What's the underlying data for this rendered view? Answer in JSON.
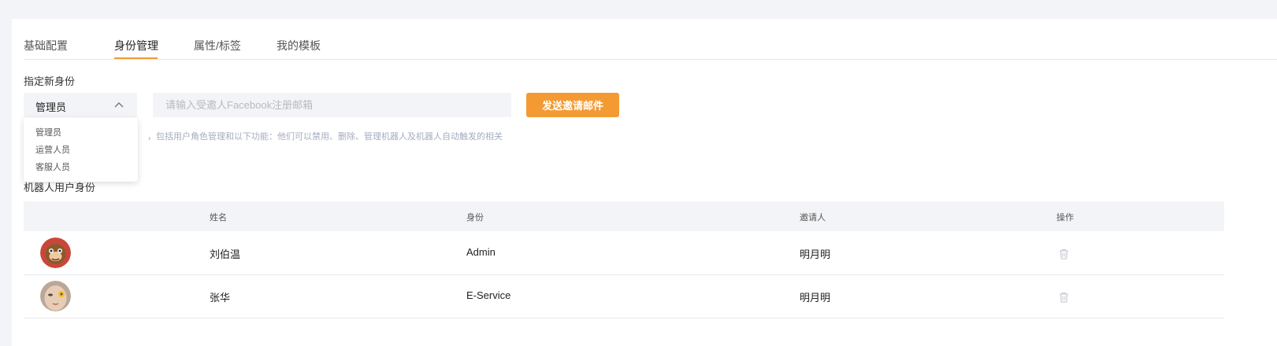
{
  "tabs": [
    {
      "label": "基础配置"
    },
    {
      "label": "身份管理"
    },
    {
      "label": "属性/标签"
    },
    {
      "label": "我的模板"
    }
  ],
  "active_tab": "身份管理",
  "invite": {
    "section_label": "指定新身份",
    "selected_role": "管理员",
    "email_placeholder": "请输入受邀人Facebook注册邮箱",
    "email_value": "",
    "send_label": "发送邀请邮件",
    "description_visible": "，包括用户角色管理和以下功能：他们可以禁用、删除、管理机器人及机器人自动触发的相关",
    "description_line2": "机器人用户身份"
  },
  "role_dropdown": {
    "open": true,
    "options": [
      "管理员",
      "运营人员",
      "客服人员"
    ]
  },
  "table": {
    "columns": [
      "",
      "姓名",
      "身份",
      "邀请人",
      "操作"
    ],
    "rows": [
      {
        "avatar": "avatar-1",
        "name": "刘伯温",
        "role": "Admin",
        "inviter": "明月明",
        "action_icon": "trash-icon"
      },
      {
        "avatar": "avatar-2",
        "name": "张华",
        "role": "E-Service",
        "inviter": "明月明",
        "action_icon": "trash-icon"
      }
    ]
  },
  "colors": {
    "accent": "#f39a33",
    "background": "#f3f4f7",
    "muted_text": "#a5acc0"
  }
}
